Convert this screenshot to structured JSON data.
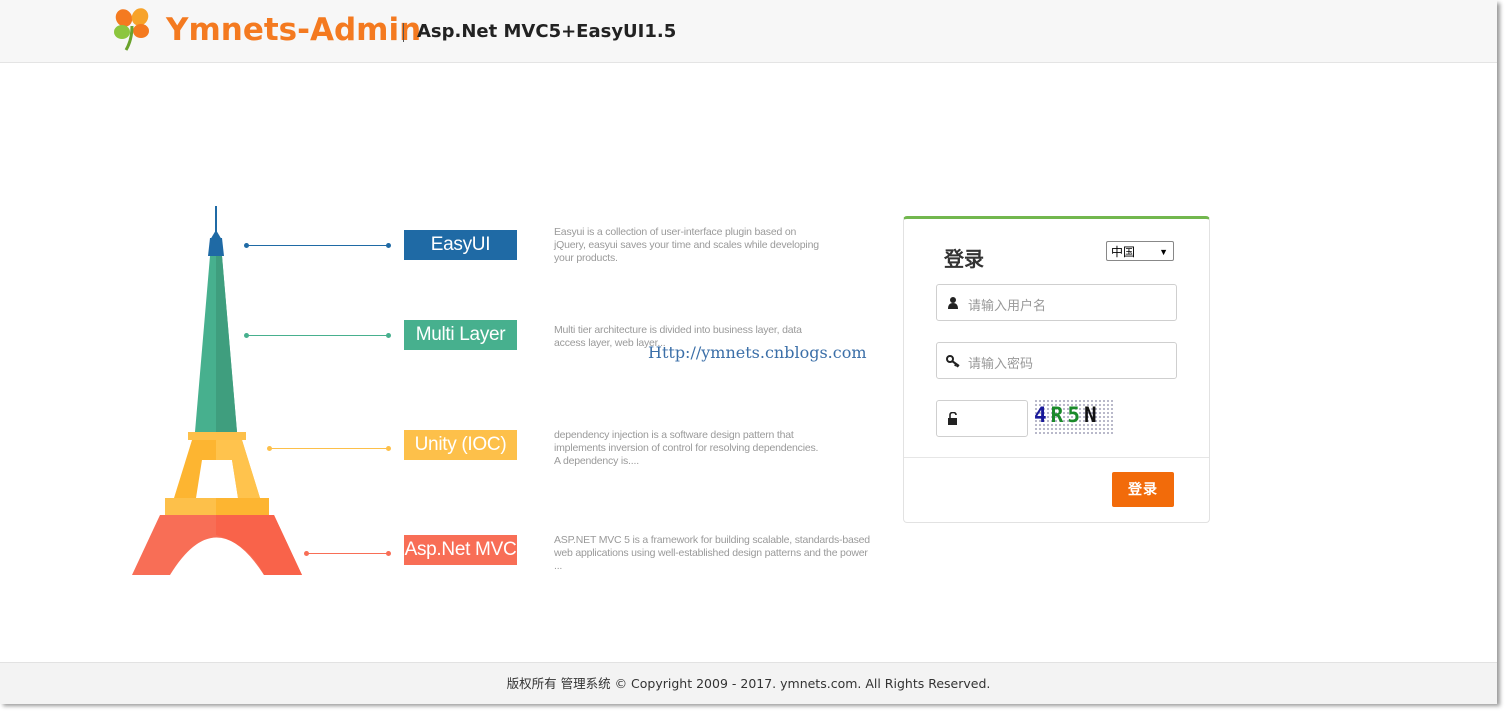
{
  "header": {
    "brand": "Ymnets-Admin",
    "subtitle": "Asp.Net MVC5+EasyUI1.5",
    "logo_icon": "four-leaf-clover-icon"
  },
  "features": [
    {
      "label": "EasyUI",
      "color": "#1f6aa5",
      "description": "Easyui is a collection of user-interface plugin based on jQuery, easyui saves your time and scales while developing your products."
    },
    {
      "label": "Multi Layer",
      "color": "#47b08e",
      "description": "Multi tier architecture is divided into business layer, data access layer, web layer..."
    },
    {
      "label": "Unity (IOC)",
      "color": "#fdc04a",
      "description": "dependency injection is a software design pattern that implements inversion of control for resolving dependencies. A dependency is...."
    },
    {
      "label": "Asp.Net MVC",
      "color": "#f86e56",
      "description": "ASP.NET MVC 5 is a framework for building scalable, standards-based web applications using well-established design patterns and the power ..."
    }
  ],
  "watermark": "Http://ymnets.cnblogs.com",
  "login": {
    "title": "登录",
    "language": "中国",
    "username_placeholder": "请输入用户名",
    "password_placeholder": "请输入密码",
    "captcha_value": "",
    "captcha_text": [
      "4",
      "R",
      "5",
      "N"
    ],
    "submit_label": "登录",
    "accent": "#f26b0a",
    "top_border_color": "#72b74e"
  },
  "footer": {
    "text": "版权所有 管理系统 © Copyright 2009 - 2017. ymnets.com. All Rights Reserved."
  }
}
